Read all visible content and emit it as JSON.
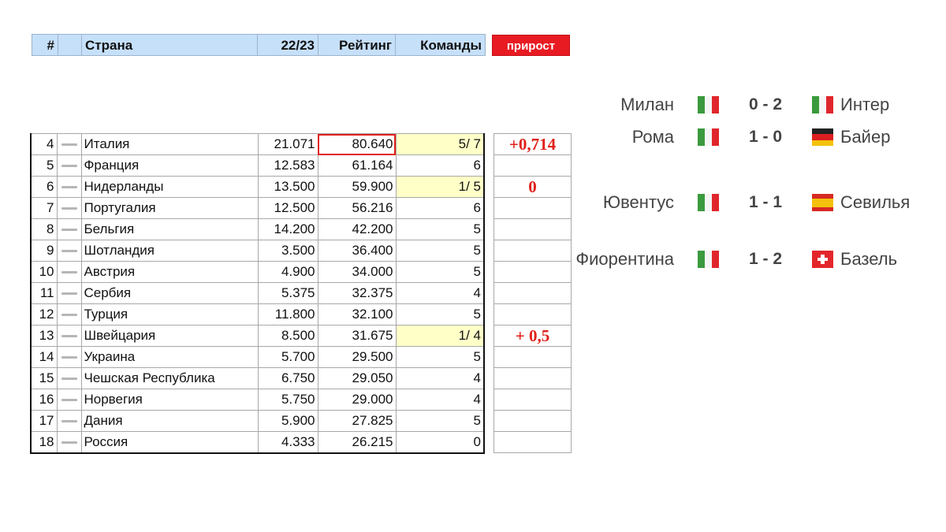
{
  "header": {
    "num": "#",
    "blank": "",
    "country": "Страна",
    "season": "22/23",
    "rating": "Рейтинг",
    "teams": "Команды",
    "growth_button": "прирост"
  },
  "rows": [
    {
      "pos": "4",
      "country": "Италия",
      "season": "21.071",
      "rating": "80.640",
      "teams": "5/ 7",
      "growth": "+0,714"
    },
    {
      "pos": "5",
      "country": "Франция",
      "season": "12.583",
      "rating": "61.164",
      "teams": "6",
      "growth": ""
    },
    {
      "pos": "6",
      "country": "Нидерланды",
      "season": "13.500",
      "rating": "59.900",
      "teams": "1/ 5",
      "growth": "0"
    },
    {
      "pos": "7",
      "country": "Португалия",
      "season": "12.500",
      "rating": "56.216",
      "teams": "6",
      "growth": ""
    },
    {
      "pos": "8",
      "country": "Бельгия",
      "season": "14.200",
      "rating": "42.200",
      "teams": "5",
      "growth": ""
    },
    {
      "pos": "9",
      "country": "Шотландия",
      "season": "3.500",
      "rating": "36.400",
      "teams": "5",
      "growth": ""
    },
    {
      "pos": "10",
      "country": "Австрия",
      "season": "4.900",
      "rating": "34.000",
      "teams": "5",
      "growth": ""
    },
    {
      "pos": "11",
      "country": "Сербия",
      "season": "5.375",
      "rating": "32.375",
      "teams": "4",
      "growth": ""
    },
    {
      "pos": "12",
      "country": "Турция",
      "season": "11.800",
      "rating": "32.100",
      "teams": "5",
      "growth": ""
    },
    {
      "pos": "13",
      "country": "Швейцария",
      "season": "8.500",
      "rating": "31.675",
      "teams": "1/ 4",
      "growth": "+ 0,5"
    },
    {
      "pos": "14",
      "country": "Украина",
      "season": "5.700",
      "rating": "29.500",
      "teams": "5",
      "growth": ""
    },
    {
      "pos": "15",
      "country": "Чешская Республика",
      "season": "6.750",
      "rating": "29.050",
      "teams": "4",
      "growth": ""
    },
    {
      "pos": "16",
      "country": "Норвегия",
      "season": "5.750",
      "rating": "29.000",
      "teams": "4",
      "growth": ""
    },
    {
      "pos": "17",
      "country": "Дания",
      "season": "5.900",
      "rating": "27.825",
      "teams": "5",
      "growth": ""
    },
    {
      "pos": "18",
      "country": "Россия",
      "season": "4.333",
      "rating": "26.215",
      "teams": "0",
      "growth": ""
    }
  ],
  "matches": [
    {
      "home": "Милан",
      "home_flag": "it-flag-icon",
      "score": "0 - 2",
      "away": "Интер",
      "away_flag": "it-flag-icon"
    },
    {
      "home": "Рома",
      "home_flag": "it-flag-icon",
      "score": "1 - 0",
      "away": "Байер",
      "away_flag": "de-flag-icon"
    },
    {
      "home": "Ювентус",
      "home_flag": "it-flag-icon",
      "score": "1 - 1",
      "away": "Севилья",
      "away_flag": "es-flag-icon"
    },
    {
      "home": "Фиорентина",
      "home_flag": "it-flag-icon",
      "score": "1 - 2",
      "away": "Базель",
      "away_flag": "ch-flag-icon"
    }
  ],
  "colors": {
    "header_bg": "#c6e0fa",
    "growth_button_bg": "#e81b23",
    "growth_text": "#e0201a",
    "teams_highlight": "#ffffc8",
    "rating_highlight_border": "#e0211d"
  }
}
